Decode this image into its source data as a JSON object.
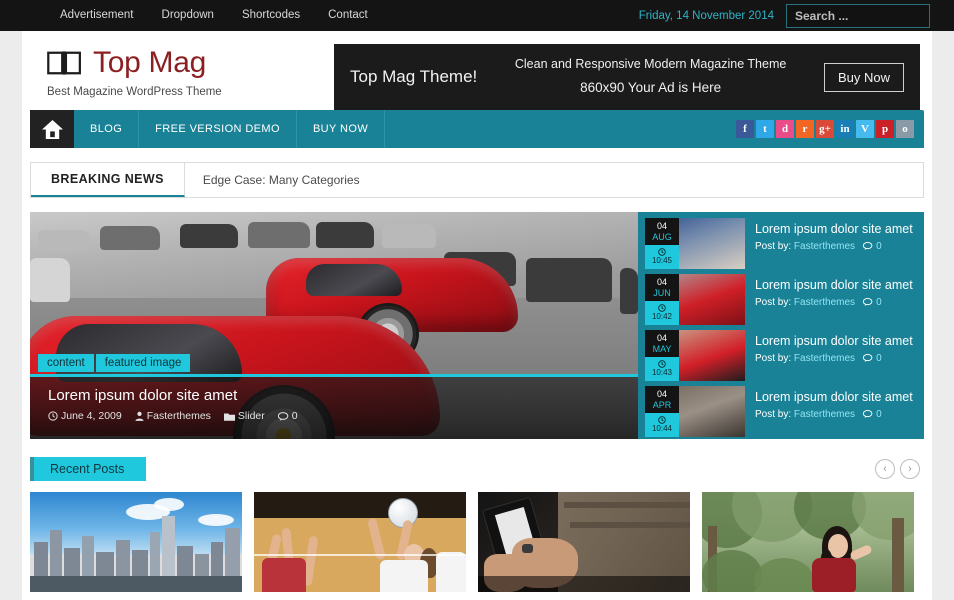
{
  "topbar": {
    "nav": [
      {
        "label": "Advertisement"
      },
      {
        "label": "Dropdown"
      },
      {
        "label": "Shortcodes"
      },
      {
        "label": "Contact"
      }
    ],
    "date": "Friday, 14 November 2014",
    "search_placeholder": "Search ...",
    "search_value": "",
    "search_icon": "search-icon",
    "accent": "#2fb3c6"
  },
  "header": {
    "logo_icon": "open-book-icon",
    "title": "Top Mag",
    "tagline": "Best Magazine WordPress Theme",
    "title_color": "#8b2022"
  },
  "ad": {
    "left_text": "Top Mag Theme!",
    "line1": "Clean and Responsive Modern Magazine Theme",
    "line2": "860x90 Your Ad is Here",
    "button": "Buy Now",
    "background": "#1b1b1b"
  },
  "mainnav": {
    "home_icon": "home-icon",
    "items": [
      {
        "label": "BLOG"
      },
      {
        "label": "FREE VERSION DEMO"
      },
      {
        "label": "BUY NOW"
      }
    ],
    "background": "#1a8296",
    "social": [
      {
        "name": "facebook-icon",
        "glyph": "f",
        "color": "#3b5998"
      },
      {
        "name": "twitter-icon",
        "glyph": "t",
        "color": "#2fa8e8"
      },
      {
        "name": "dribbble-icon",
        "glyph": "d",
        "color": "#ea4c89"
      },
      {
        "name": "rss-icon",
        "glyph": "r",
        "color": "#f26522"
      },
      {
        "name": "google-plus-icon",
        "glyph": "g+",
        "color": "#db4a39"
      },
      {
        "name": "linkedin-icon",
        "glyph": "in",
        "color": "#1a7eb6"
      },
      {
        "name": "vimeo-icon",
        "glyph": "V",
        "color": "#45bbf0"
      },
      {
        "name": "pinterest-icon",
        "glyph": "p",
        "color": "#cb2027"
      },
      {
        "name": "instagram-icon",
        "glyph": "o",
        "color": "#8a9aa6"
      }
    ]
  },
  "breaking": {
    "label": "BREAKING NEWS",
    "item": "Edge Case: Many Categories"
  },
  "slider": {
    "categories": [
      "content",
      "featured image"
    ],
    "title": "Lorem ipsum dolor site amet",
    "meta": {
      "date_icon": "clock-icon",
      "date": "June 4, 2009",
      "author_icon": "user-icon",
      "author": "Fasterthemes",
      "category_icon": "folder-icon",
      "category": "Slider",
      "comment_icon": "comment-icon",
      "comments": "0"
    },
    "accent": "#1fc8dd"
  },
  "side_posts": [
    {
      "day": "04",
      "month": "AUG",
      "time": "10:45",
      "title": "Lorem ipsum dolor site amet",
      "postby_label": "Post by:",
      "author": "Fasterthemes",
      "comments": "0",
      "thumb": "crowd-photo"
    },
    {
      "day": "04",
      "month": "JUN",
      "time": "10:42",
      "title": "Lorem ipsum dolor site amet",
      "postby_label": "Post by:",
      "author": "Fasterthemes",
      "comments": "0",
      "thumb": "red-car-photo"
    },
    {
      "day": "04",
      "month": "MAY",
      "time": "10:43",
      "title": "Lorem ipsum dolor site amet",
      "postby_label": "Post by:",
      "author": "Fasterthemes",
      "comments": "0",
      "thumb": "red-car-street-photo"
    },
    {
      "day": "04",
      "month": "APR",
      "time": "10:44",
      "title": "Lorem ipsum dolor site amet",
      "postby_label": "Post by:",
      "author": "Fasterthemes",
      "comments": "0",
      "thumb": "city-traffic-photo"
    }
  ],
  "recent": {
    "tab_label": "Recent Posts",
    "prev_icon": "chevron-left-icon",
    "prev_glyph": "‹",
    "next_icon": "chevron-right-icon",
    "next_glyph": "›",
    "cards": [
      {
        "name": "city-skyline-photo"
      },
      {
        "name": "volleyball-photo"
      },
      {
        "name": "hands-phone-photo"
      },
      {
        "name": "woman-in-red-photo"
      }
    ]
  }
}
